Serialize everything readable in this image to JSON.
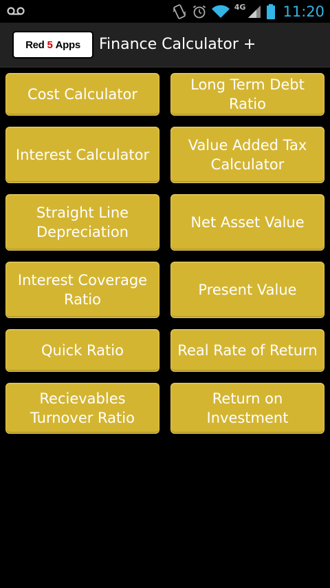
{
  "status_bar": {
    "time": "11:20",
    "network": "4G",
    "icons": [
      "voicemail-icon",
      "vibrate-icon",
      "alarm-icon",
      "wifi-icon",
      "signal-icon",
      "battery-icon"
    ]
  },
  "action_bar": {
    "logo": {
      "part1": "Red",
      "part2": "5",
      "part3": "Apps"
    },
    "title": "Finance Calculator +"
  },
  "buttons": [
    {
      "label": "Cost Calculator"
    },
    {
      "label": "Long Term Debt Ratio"
    },
    {
      "label": "Interest Calculator"
    },
    {
      "label": "Value Added Tax Calculator"
    },
    {
      "label": "Straight Line Depreciation"
    },
    {
      "label": "Net Asset Value"
    },
    {
      "label": "Interest Coverage Ratio"
    },
    {
      "label": "Present Value"
    },
    {
      "label": "Quick Ratio"
    },
    {
      "label": "Real Rate of Return"
    },
    {
      "label": "Recievables Turnover Ratio"
    },
    {
      "label": "Return on Investment"
    }
  ],
  "colors": {
    "button_bg": "#d4b531",
    "clock": "#33b5e5",
    "logo_accent": "#d40000"
  }
}
